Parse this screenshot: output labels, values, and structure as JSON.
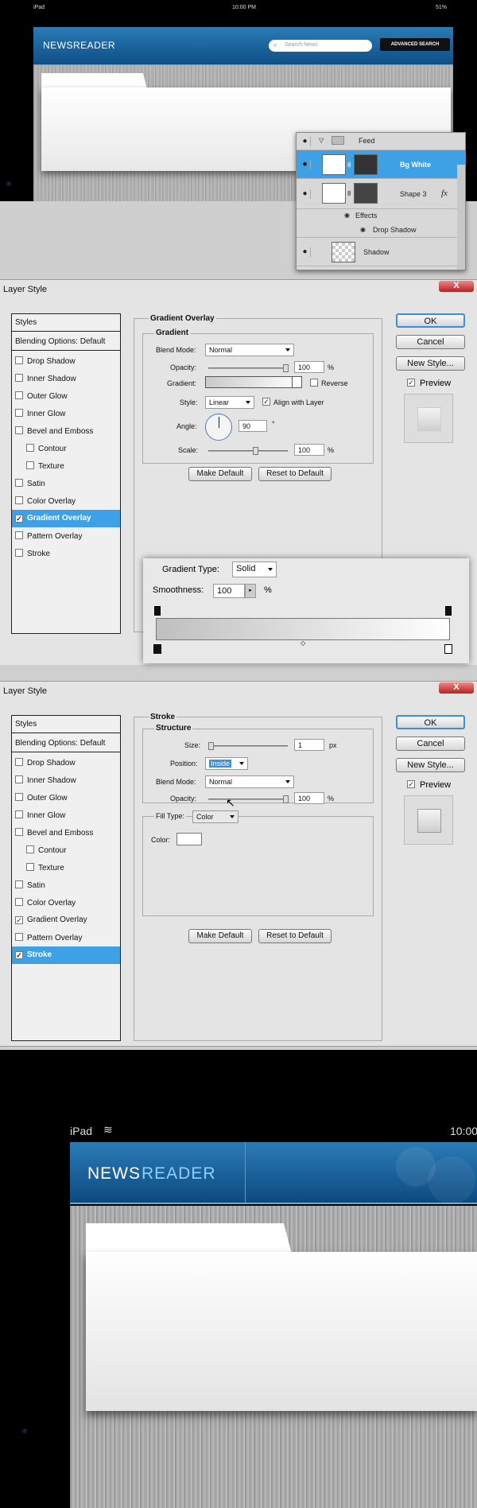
{
  "top_screen": {
    "status_left": "iPad",
    "status_time": "10:00 PM",
    "status_battery": "51%",
    "app_logo": "NEWSREADER",
    "search_placeholder": "Search News",
    "advanced_search": "ADVANCED SEARCH"
  },
  "layers_panel": {
    "group_name": "Feed",
    "layers": [
      "Bg White",
      "Shape 3",
      "Effects",
      "Drop Shadow",
      "Shadow"
    ],
    "fx_label": "fx"
  },
  "dialog1": {
    "title": "Layer Style",
    "close": "X",
    "styles_header": "Styles",
    "blending": "Blending Options: Default",
    "items": [
      "Drop Shadow",
      "Inner Shadow",
      "Outer Glow",
      "Inner Glow",
      "Bevel and Emboss",
      "Contour",
      "Texture",
      "Satin",
      "Color Overlay",
      "Gradient Overlay",
      "Pattern Overlay",
      "Stroke"
    ],
    "section_title": "Gradient Overlay",
    "group_title": "Gradient",
    "blend_mode_label": "Blend Mode:",
    "blend_mode": "Normal",
    "opacity_label": "Opacity:",
    "opacity": "100",
    "pct": "%",
    "gradient_label": "Gradient:",
    "reverse": "Reverse",
    "style_label": "Style:",
    "style": "Linear",
    "align": "Align with Layer",
    "angle_label": "Angle:",
    "angle": "90",
    "deg": "°",
    "scale_label": "Scale:",
    "scale": "100",
    "make_default": "Make Default",
    "reset_default": "Reset to Default",
    "ok": "OK",
    "cancel": "Cancel",
    "new_style": "New Style...",
    "preview": "Preview",
    "gradient_type_label": "Gradient Type:",
    "gradient_type": "Solid",
    "smoothness_label": "Smoothness:",
    "smoothness": "100"
  },
  "dialog2": {
    "title": "Layer Style",
    "close": "X",
    "styles_header": "Styles",
    "blending": "Blending Options: Default",
    "items": [
      "Drop Shadow",
      "Inner Shadow",
      "Outer Glow",
      "Inner Glow",
      "Bevel and Emboss",
      "Contour",
      "Texture",
      "Satin",
      "Color Overlay",
      "Gradient Overlay",
      "Pattern Overlay",
      "Stroke"
    ],
    "section_title": "Stroke",
    "group_title": "Structure",
    "size_label": "Size:",
    "size": "1",
    "px": "px",
    "position_label": "Position:",
    "position": "Inside",
    "blend_mode_label": "Blend Mode:",
    "blend_mode": "Normal",
    "opacity_label": "Opacity:",
    "opacity": "100",
    "pct": "%",
    "fill_type_label": "Fill Type:",
    "fill_type": "Color",
    "color_label": "Color:",
    "make_default": "Make Default",
    "reset_default": "Reset to Default",
    "ok": "OK",
    "cancel": "Cancel",
    "new_style": "New Style...",
    "preview": "Preview"
  },
  "bottom_screen": {
    "status_left": "iPad",
    "status_time": "10:00",
    "app_logo_a": "NEWS",
    "app_logo_b": "READER"
  },
  "colors": {
    "accent": "#3ea1e6",
    "header_blue": "#0e4f86"
  }
}
